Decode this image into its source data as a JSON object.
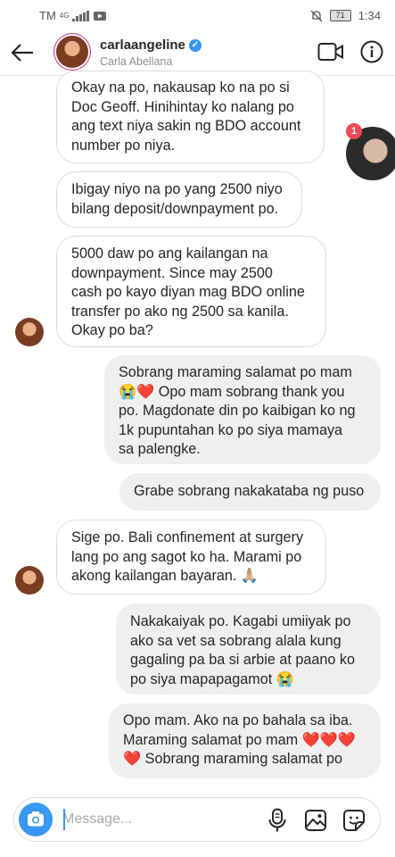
{
  "status": {
    "carrier": "TM",
    "network": "4G",
    "battery": "71",
    "time": "1:34"
  },
  "header": {
    "username": "carlaangeline",
    "fullname": "Carla Abellana",
    "verified_mark": "✓"
  },
  "chathead": {
    "badge": "1"
  },
  "messages": [
    {
      "dir": "in",
      "text": "Okay na po, nakausap ko na po si\nDoc Geoff. Hinihintay ko nalang po\nang text niya sakin ng BDO account\nnumber po niya."
    },
    {
      "dir": "in",
      "text": "Ibigay niyo na po yang 2500 niyo\nbilang deposit/downpayment po."
    },
    {
      "dir": "in",
      "text": "5000 daw po ang kailangan na\ndownpayment. Since may 2500\ncash po kayo diyan mag BDO online\ntransfer po ako ng 2500 sa kanila.\nOkay po ba?"
    },
    {
      "dir": "out",
      "text": "Sobrang maraming salamat po mam\n😭❤️ Opo mam sobrang thank you\npo. Magdonate din po kaibigan ko ng\n1k pupuntahan ko po siya mamaya\nsa palengke."
    },
    {
      "dir": "out",
      "text": "Grabe sobrang nakakataba ng puso"
    },
    {
      "dir": "in",
      "text": "Sige po. Bali confinement at surgery\nlang po ang sagot ko ha. Marami po\nakong kailangan bayaran. 🙏🏼"
    },
    {
      "dir": "out",
      "text": "Nakakaiyak po. Kagabi umiiyak po\nako sa vet sa sobrang alala kung\ngagaling pa ba si arbie at paano ko\npo siya mapapagamot 😭"
    },
    {
      "dir": "out",
      "text": "Opo mam. Ako na po bahala sa iba.\nMaraming salamat po mam ❤️❤️❤️\n❤️ Sobrang maraming salamat po"
    }
  ],
  "composer": {
    "placeholder": "Message..."
  },
  "colors": {
    "accent": "#3897f0",
    "badge": "#ed4956",
    "heart": "#e0245e"
  }
}
